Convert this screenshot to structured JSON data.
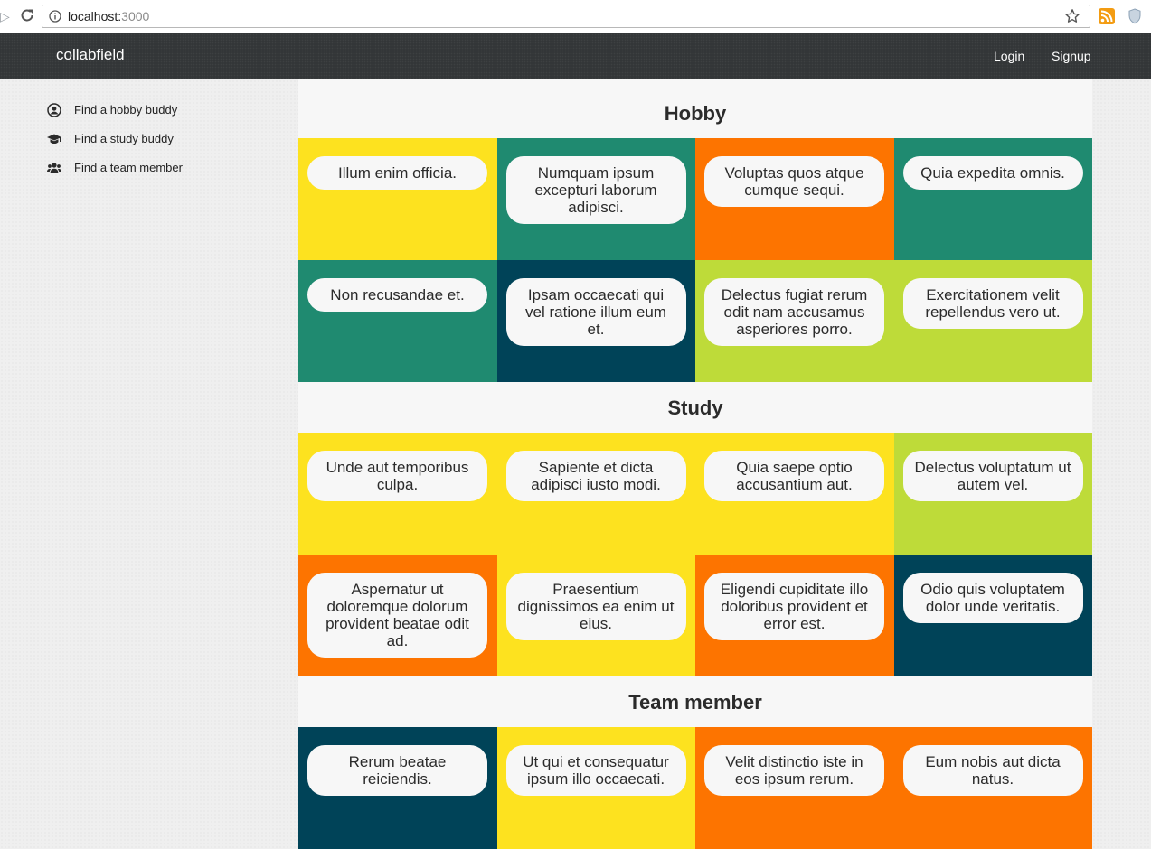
{
  "browser": {
    "url_host": "localhost:",
    "url_port": "3000"
  },
  "navbar": {
    "brand": "collabfield",
    "login": "Login",
    "signup": "Signup"
  },
  "sidebar": {
    "items": [
      {
        "label": "Find a hobby buddy",
        "icon": "user-circle-icon"
      },
      {
        "label": "Find a study buddy",
        "icon": "graduation-cap-icon"
      },
      {
        "label": "Find a team member",
        "icon": "users-icon"
      }
    ]
  },
  "colors": {
    "yellow": "#fde21f",
    "teal": "#1f8a70",
    "orange": "#fd7400",
    "navy": "#004358",
    "lime": "#bedb39",
    "navbar": "#333638",
    "main_bg": "#f7f7f7"
  },
  "sections": [
    {
      "title": "Hobby",
      "cards": [
        {
          "text": "Illum enim officia.",
          "color": "#fde21f"
        },
        {
          "text": "Numquam ipsum excepturi laborum adipisci.",
          "color": "#1f8a70"
        },
        {
          "text": "Voluptas quos atque cumque sequi.",
          "color": "#fd7400"
        },
        {
          "text": "Quia expedita omnis.",
          "color": "#1f8a70"
        },
        {
          "text": "Non recusandae et.",
          "color": "#1f8a70"
        },
        {
          "text": "Ipsam occaecati qui vel ratione illum eum et.",
          "color": "#004358"
        },
        {
          "text": "Delectus fugiat rerum odit nam accusamus asperiores porro.",
          "color": "#bedb39"
        },
        {
          "text": "Exercitationem velit repellendus vero ut.",
          "color": "#bedb39"
        }
      ]
    },
    {
      "title": "Study",
      "cards": [
        {
          "text": "Unde aut temporibus culpa.",
          "color": "#fde21f"
        },
        {
          "text": "Sapiente et dicta adipisci iusto modi.",
          "color": "#fde21f"
        },
        {
          "text": "Quia saepe optio accusantium aut.",
          "color": "#fde21f"
        },
        {
          "text": "Delectus voluptatum ut autem vel.",
          "color": "#bedb39"
        },
        {
          "text": "Aspernatur ut doloremque dolorum provident beatae odit ad.",
          "color": "#fd7400"
        },
        {
          "text": "Praesentium dignissimos ea enim ut eius.",
          "color": "#fde21f"
        },
        {
          "text": "Eligendi cupiditate illo doloribus provident et error est.",
          "color": "#fd7400"
        },
        {
          "text": "Odio quis voluptatem dolor unde veritatis.",
          "color": "#004358"
        }
      ]
    },
    {
      "title": "Team member",
      "cards": [
        {
          "text": "Rerum beatae reiciendis.",
          "color": "#004358"
        },
        {
          "text": "Ut qui et consequatur ipsum illo occaecati.",
          "color": "#fde21f"
        },
        {
          "text": "Velit distinctio iste in eos ipsum rerum.",
          "color": "#fd7400"
        },
        {
          "text": "Eum nobis aut dicta natus.",
          "color": "#fd7400"
        }
      ]
    }
  ]
}
